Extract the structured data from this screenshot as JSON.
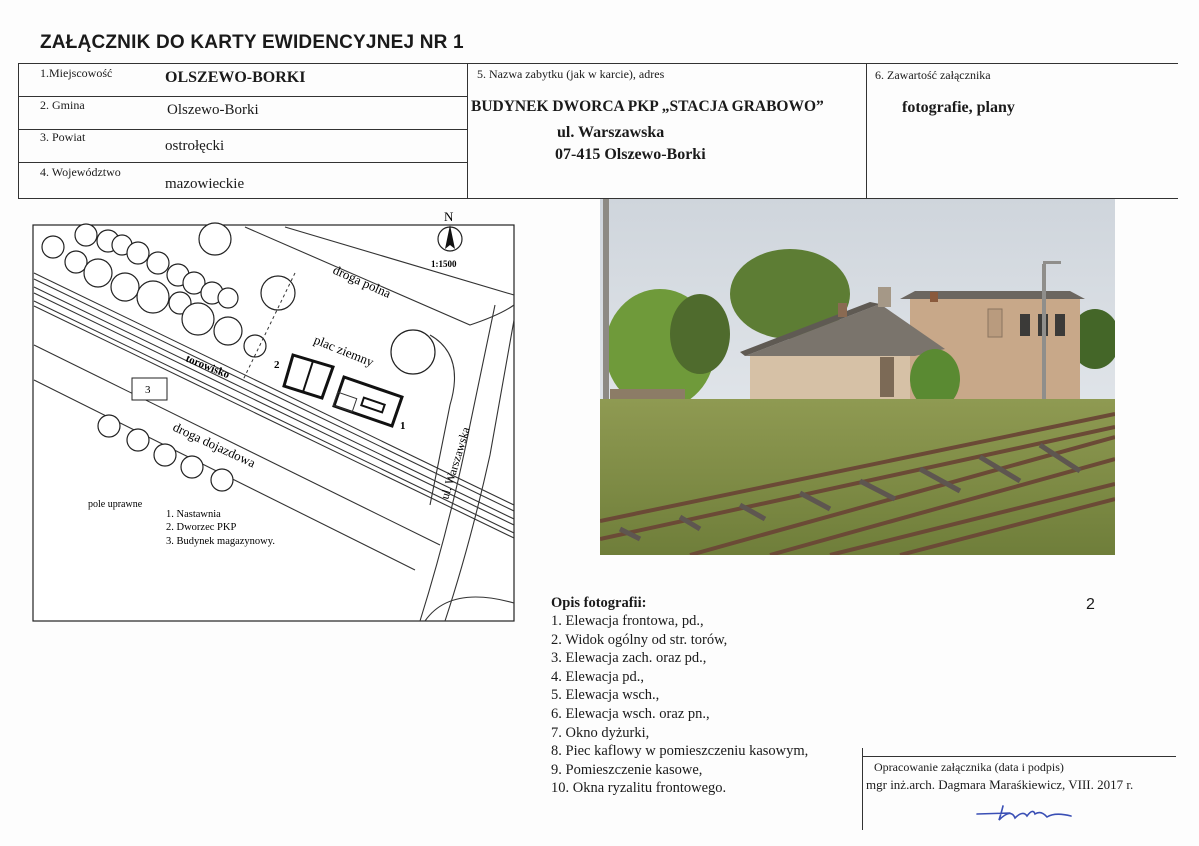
{
  "header": {
    "title": "ZAŁĄCZNIK DO KARTY EWIDENCYJNEJ NR 1"
  },
  "fields": {
    "miejscowosc_label": "1.Miejscowość",
    "miejscowosc_value": "OLSZEWO-BORKI",
    "gmina_label": "2. Gmina",
    "gmina_value": "Olszewo-Borki",
    "powiat_label": "3. Powiat",
    "powiat_value": "ostrołęcki",
    "wojewodztwo_label": "4. Województwo",
    "wojewodztwo_value": "mazowieckie",
    "nazwa_label": "5. Nazwa zabytku (jak w karcie), adres",
    "nazwa_value": "BUDYNEK DWORCA PKP „STACJA GRABOWO”",
    "address_line1": "ul. Warszawska",
    "address_line2": "07-415 Olszewo-Borki",
    "zawartosc_label": "6. Zawartość załącznika",
    "zawartosc_value": "fotografie, plany"
  },
  "map": {
    "north": "N",
    "scale": "1:1500",
    "road_polna": "droga polna",
    "plac": "plac ziemny",
    "torowisko": "torowisko",
    "road_dojazdowa": "droga dojazdowa",
    "street": "ul. Warszawska",
    "label_1": "1",
    "label_2": "2",
    "label_3": "3",
    "fields_label": "pole uprawne",
    "legend": [
      "1. Nastawnia",
      "2. Dworzec PKP",
      "3. Budynek magazynowy."
    ]
  },
  "photo": {
    "page_number": "2"
  },
  "description": {
    "heading": "Opis fotografii:",
    "items": [
      "1. Elewacja frontowa, pd.,",
      "2. Widok ogólny od str. torów,",
      "3. Elewacja zach. oraz pd.,",
      "4. Elewacja pd.,",
      "5. Elewacja wsch.,",
      "6. Elewacja wsch. oraz pn.,",
      "7. Okno dyżurki,",
      "8. Piec kaflowy w pomieszczeniu kasowym,",
      "9. Pomieszczenie kasowe,",
      "10. Okna ryzalitu frontowego."
    ]
  },
  "footer": {
    "label": "Opracowanie załącznika (data i podpis)",
    "author": "mgr inż.arch. Dagmara Maraśkiewicz, VIII. 2017 r."
  },
  "colors": {
    "signature": "#3a4fb5",
    "sky": "#dfe4ea",
    "grass": "#7e8f46",
    "rail": "#6b4a36"
  }
}
